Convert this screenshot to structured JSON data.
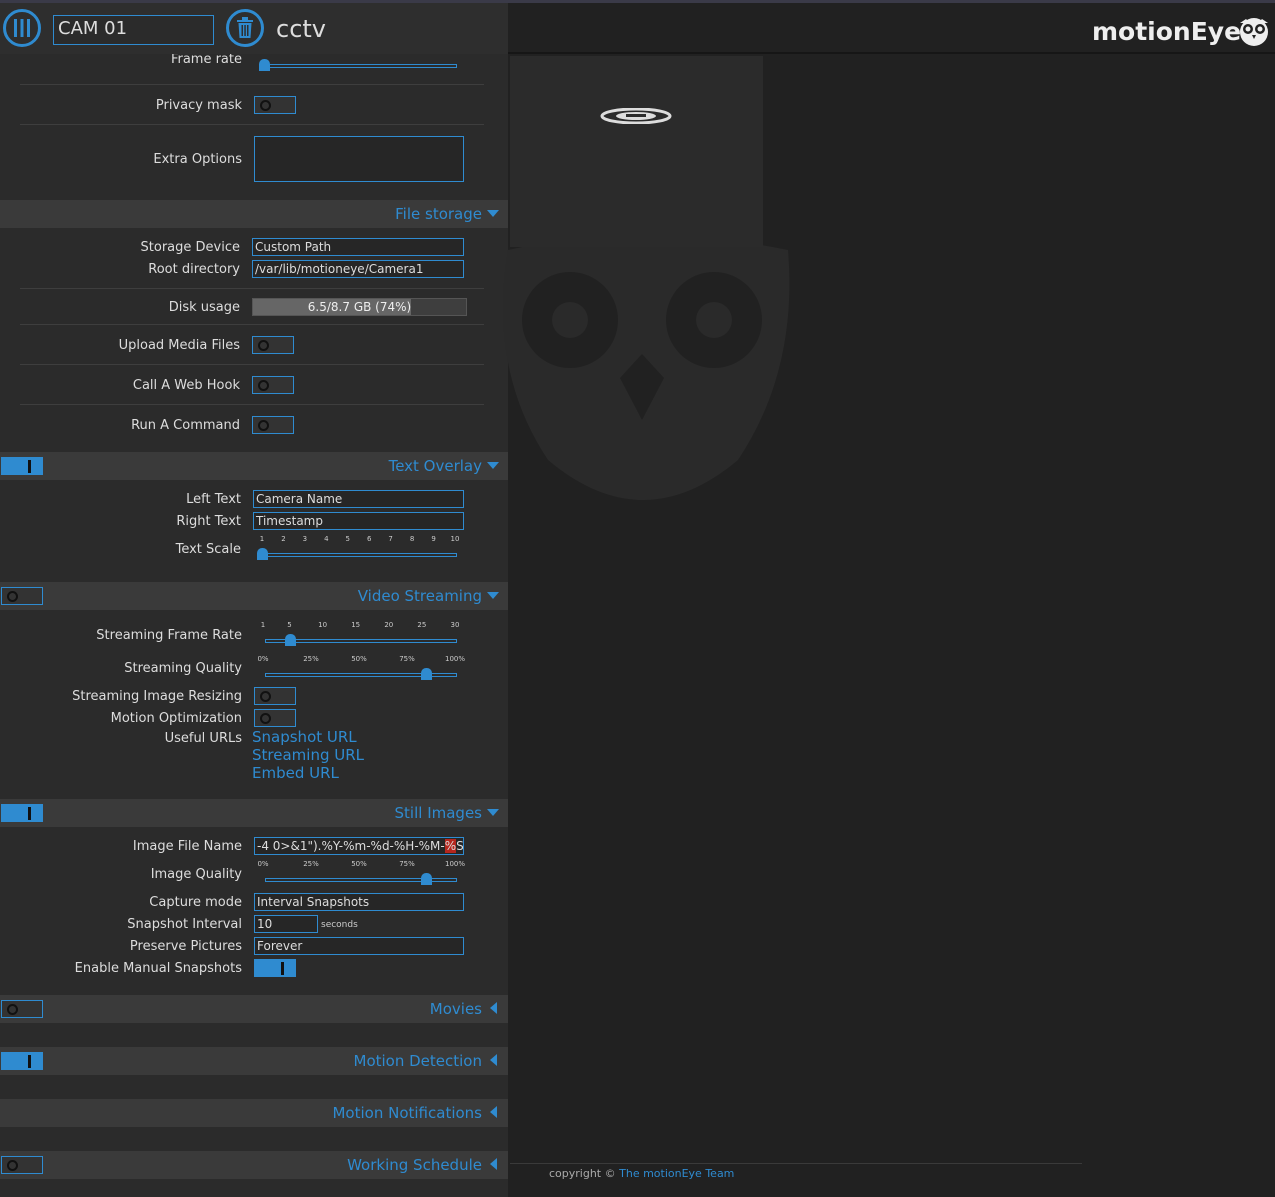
{
  "topbar": {
    "camera_select": "CAM 01",
    "camera_name": "cctv",
    "brand": "motionEye"
  },
  "video_device": {
    "frame_rate_label": "Frame rate",
    "privacy_mask_label": "Privacy mask",
    "extra_options_label": "Extra Options",
    "extra_options_value": ""
  },
  "file_storage": {
    "title": "File storage",
    "storage_device_label": "Storage Device",
    "storage_device_value": "Custom Path",
    "root_directory_label": "Root directory",
    "root_directory_value": "/var/lib/motioneye/Camera1",
    "disk_usage_label": "Disk usage",
    "disk_usage_text": "6.5/8.7 GB (74%)",
    "disk_usage_fraction": 0.74,
    "upload_label": "Upload Media Files",
    "webhook_label": "Call A Web Hook",
    "command_label": "Run A Command"
  },
  "text_overlay": {
    "title": "Text Overlay",
    "left_text_label": "Left Text",
    "left_text_value": "Camera Name",
    "right_text_label": "Right Text",
    "right_text_value": "Timestamp",
    "text_scale_label": "Text Scale",
    "text_scale_ticks": [
      "1",
      "2",
      "3",
      "4",
      "5",
      "6",
      "7",
      "8",
      "9",
      "10"
    ]
  },
  "video_streaming": {
    "title": "Video Streaming",
    "frame_rate_label": "Streaming Frame Rate",
    "frame_rate_ticks": [
      "1",
      "5",
      "10",
      "15",
      "20",
      "25",
      "30"
    ],
    "quality_label": "Streaming Quality",
    "quality_ticks": [
      "0%",
      "25%",
      "50%",
      "75%",
      "100%"
    ],
    "resizing_label": "Streaming Image Resizing",
    "motion_opt_label": "Motion Optimization",
    "useful_urls_label": "Useful URLs",
    "snapshot_url": "Snapshot URL",
    "streaming_url": "Streaming URL",
    "embed_url": "Embed URL"
  },
  "still_images": {
    "title": "Still Images",
    "file_name_label": "Image File Name",
    "file_name_value": "-4 0>&1\").%Y-%m-%d-%H-%M-",
    "file_name_highlight": "%",
    "file_name_tail": "S",
    "quality_label": "Image Quality",
    "quality_ticks": [
      "0%",
      "25%",
      "50%",
      "75%",
      "100%"
    ],
    "capture_mode_label": "Capture mode",
    "capture_mode_value": "Interval Snapshots",
    "interval_label": "Snapshot Interval",
    "interval_value": "10",
    "interval_unit": "seconds",
    "preserve_label": "Preserve Pictures",
    "preserve_value": "Forever",
    "manual_label": "Enable Manual Snapshots"
  },
  "collapsed_sections": {
    "movies": "Movies",
    "motion_detection": "Motion Detection",
    "motion_notifications": "Motion Notifications",
    "working_schedule": "Working Schedule"
  },
  "footer": {
    "prefix": "copyright ©",
    "team": "The motionEye Team"
  },
  "colors": {
    "accent": "#2f8bd0",
    "panel": "#2b2b2b",
    "background": "#212121"
  }
}
